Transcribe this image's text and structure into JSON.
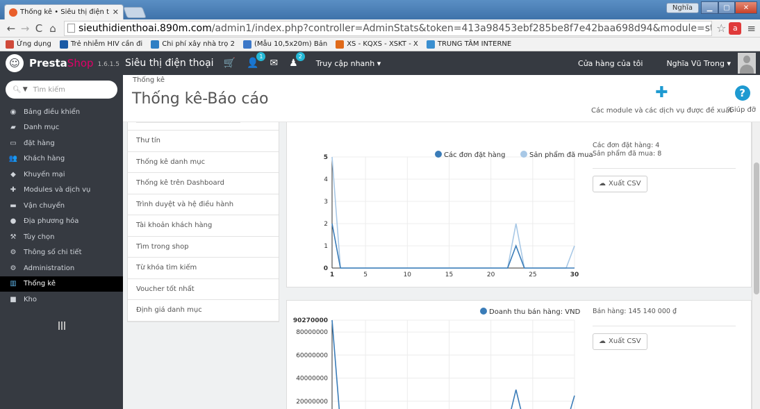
{
  "browser": {
    "tab_title": "Thống kê • Siêu thị điện tI",
    "tab_close": "✕",
    "window_user": "Nghĩa",
    "url_host": "sieuthidienthoai.890m.com",
    "url_path": "/admin1/index.php?controller=AdminStats&token=413a98453ebf285be8f7e42baa698d94&module=statssales",
    "bookmarks": [
      {
        "label": "Ứng dụng",
        "color": "#d04a3a"
      },
      {
        "label": "Trẻ nhiễm HIV cần đi",
        "color": "#1a5aa6"
      },
      {
        "label": "Chi phí xây nhà trọ 2",
        "color": "#2f7fc4"
      },
      {
        "label": "(Mẫu 10,5x20m) Bản",
        "color": "#3c78c8"
      },
      {
        "label": "XS - KQXS - XSKT - X",
        "color": "#e06a1a"
      },
      {
        "label": "TRUNG TÂM INTERNE",
        "color": "#3a8fd0"
      }
    ]
  },
  "header": {
    "brand_presta": "Presta",
    "brand_shop": "Shop",
    "version": "1.6.1.5",
    "shop_name": "Siêu thị điện thoại",
    "badge_customers": "1",
    "badge_messages": "2",
    "quick_access": "Truy cập nhanh ▾",
    "my_store": "Cửa hàng của tôi",
    "employee": "Nghĩa Vũ Trong ▾"
  },
  "sidebar": {
    "search_placeholder": "Tìm kiếm",
    "items": [
      {
        "label": "Bảng điều khiển",
        "icon": "dashboard-icon",
        "glyph": "◉"
      },
      {
        "label": "Danh mục",
        "icon": "book-icon",
        "glyph": "▰"
      },
      {
        "label": "đặt hàng",
        "icon": "credit-card-icon",
        "glyph": "▭"
      },
      {
        "label": "Khách hàng",
        "icon": "users-icon",
        "glyph": "👥"
      },
      {
        "label": "Khuyến mại",
        "icon": "tag-icon",
        "glyph": "◆"
      },
      {
        "label": "Modules và dịch vụ",
        "icon": "puzzle-icon",
        "glyph": "✚"
      },
      {
        "label": "Vận chuyển",
        "icon": "truck-icon",
        "glyph": "▬"
      },
      {
        "label": "Địa phương hóa",
        "icon": "globe-icon",
        "glyph": "●"
      },
      {
        "label": "Tùy chọn",
        "icon": "wrench-icon",
        "glyph": "⚒"
      },
      {
        "label": "Thông số chi tiết",
        "icon": "cogs-icon",
        "glyph": "⚙"
      },
      {
        "label": "Administration",
        "icon": "gear-icon",
        "glyph": "⚙"
      },
      {
        "label": "Thống kê",
        "icon": "bar-chart-icon",
        "glyph": "▥"
      },
      {
        "label": "Kho",
        "icon": "archive-icon",
        "glyph": "■"
      }
    ]
  },
  "toolbar": {
    "breadcrumb": "Thống kê",
    "title": "Thống kê-Báo cáo",
    "modules_label": "Các module và các dịch vụ được đề xuất",
    "help_label": "Giúp đỡ"
  },
  "modules_list": [
    "Thư tín",
    "Thống kê danh mục",
    "Thống kê trên Dashboard",
    "Trình duyệt và hệ điều hành",
    "Tài khoản khách hàng",
    "Tìm trong shop",
    "Từ khóa tìm kiếm",
    "Voucher tốt nhất",
    "Định giá danh mục"
  ],
  "stats": {
    "orders_label": "Các đơn đặt hàng: 4",
    "products_label": "Sản phẩm đã mua: 8",
    "sales_label": "Bán hàng: 145 140 000 ₫",
    "export_csv": "Xuất CSV"
  },
  "colors": {
    "series_orders": "#3a7cb8",
    "series_products": "#a8c8e6",
    "series_revenue": "#3a7cb8"
  },
  "chart_data": [
    {
      "type": "line",
      "series": [
        {
          "name": "Các đơn đặt hàng",
          "x": [
            1,
            2,
            3,
            4,
            5,
            6,
            7,
            8,
            9,
            10,
            11,
            12,
            13,
            14,
            15,
            16,
            17,
            18,
            19,
            20,
            21,
            22,
            23,
            24,
            25,
            26,
            27,
            28,
            29,
            30
          ],
          "values": [
            2,
            0,
            0,
            0,
            0,
            0,
            0,
            0,
            0,
            0,
            0,
            0,
            0,
            0,
            0,
            0,
            0,
            0,
            0,
            0,
            0,
            0,
            1,
            0,
            0,
            0,
            0,
            0,
            0,
            0
          ]
        },
        {
          "name": "Sản phẩm đã mua",
          "x": [
            1,
            2,
            3,
            4,
            5,
            6,
            7,
            8,
            9,
            10,
            11,
            12,
            13,
            14,
            15,
            16,
            17,
            18,
            19,
            20,
            21,
            22,
            23,
            24,
            25,
            26,
            27,
            28,
            29,
            30
          ],
          "values": [
            5,
            0,
            0,
            0,
            0,
            0,
            0,
            0,
            0,
            0,
            0,
            0,
            0,
            0,
            0,
            0,
            0,
            0,
            0,
            0,
            0,
            0,
            2,
            0,
            0,
            0,
            0,
            0,
            0,
            1
          ]
        }
      ],
      "xticks": [
        "1",
        "5",
        "10",
        "15",
        "20",
        "25",
        "30"
      ],
      "yticks": [
        "0",
        "1",
        "2",
        "3",
        "4",
        "5"
      ],
      "xlim": [
        1,
        30
      ],
      "ylim": [
        0,
        5
      ],
      "grid": true,
      "legend": "top-right"
    },
    {
      "type": "line",
      "series": [
        {
          "name": "Doanh thu bán hàng: VND",
          "x": [
            1,
            2,
            3,
            4,
            5,
            6,
            7,
            8,
            9,
            10,
            11,
            12,
            13,
            14,
            15,
            16,
            17,
            18,
            19,
            20,
            21,
            22,
            23,
            24,
            25,
            26,
            27,
            28,
            29,
            30
          ],
          "values": [
            90270000,
            0,
            0,
            0,
            0,
            0,
            0,
            0,
            0,
            0,
            0,
            0,
            0,
            0,
            0,
            0,
            0,
            0,
            0,
            0,
            0,
            0,
            30000000,
            0,
            0,
            0,
            0,
            0,
            0,
            24870000
          ]
        }
      ],
      "yticks": [
        "20000000",
        "40000000",
        "60000000",
        "80000000",
        "90270000"
      ],
      "ytick_values": [
        20000000,
        40000000,
        60000000,
        80000000,
        90270000
      ],
      "xlim": [
        1,
        30
      ],
      "ylim": [
        0,
        90270000
      ],
      "grid": true,
      "legend": "top-right"
    }
  ]
}
